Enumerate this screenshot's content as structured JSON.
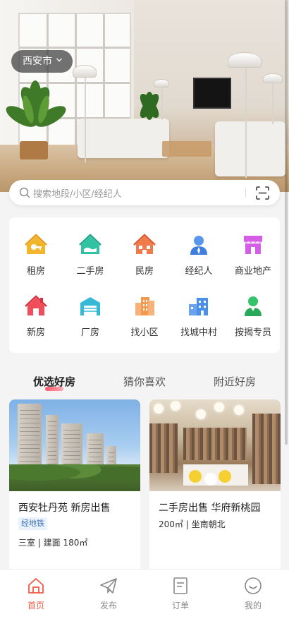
{
  "header": {
    "city": "西安市"
  },
  "search": {
    "placeholder": "搜索地段/小区/经纪人"
  },
  "categories": [
    {
      "label": "租房",
      "icon": "rent-house-icon",
      "color": "#f3b52b"
    },
    {
      "label": "二手房",
      "icon": "second-hand-house-icon",
      "color": "#2fc3a4"
    },
    {
      "label": "民房",
      "icon": "residence-house-icon",
      "color": "#f07a4a"
    },
    {
      "label": "经纪人",
      "icon": "agent-icon",
      "color": "#4a86e8"
    },
    {
      "label": "商业地产",
      "icon": "shop-icon",
      "color": "#d45ee6"
    },
    {
      "label": "新房",
      "icon": "new-house-icon",
      "color": "#f04d5a"
    },
    {
      "label": "厂房",
      "icon": "factory-icon",
      "color": "#35b9d6"
    },
    {
      "label": "找小区",
      "icon": "community-icon",
      "color": "#f39a4e"
    },
    {
      "label": "找城中村",
      "icon": "village-icon",
      "color": "#4a8fe8"
    },
    {
      "label": "按揭专员",
      "icon": "mortgage-agent-icon",
      "color": "#35c26a"
    }
  ],
  "tabs": [
    {
      "label": "优选好房",
      "active": true
    },
    {
      "label": "猜你喜欢",
      "active": false
    },
    {
      "label": "附近好房",
      "active": false
    }
  ],
  "listings": [
    {
      "title": "西安牡丹苑 新房出售",
      "tag": "经地铁",
      "meta": "三室 | 建面 180㎡"
    },
    {
      "title": "二手房出售 华府新桃园 ",
      "tag": "",
      "meta": "200㎡ | 坐南朝北"
    }
  ],
  "tabbar": [
    {
      "label": "首页",
      "icon": "home-icon",
      "active": true
    },
    {
      "label": "发布",
      "icon": "publish-icon",
      "active": false
    },
    {
      "label": "订单",
      "icon": "order-icon",
      "active": false
    },
    {
      "label": "我的",
      "icon": "profile-icon",
      "active": false
    }
  ],
  "colors": {
    "accent": "#f05a45",
    "tag_bg": "#eaf2fc",
    "tag_text": "#3a6fb7"
  }
}
